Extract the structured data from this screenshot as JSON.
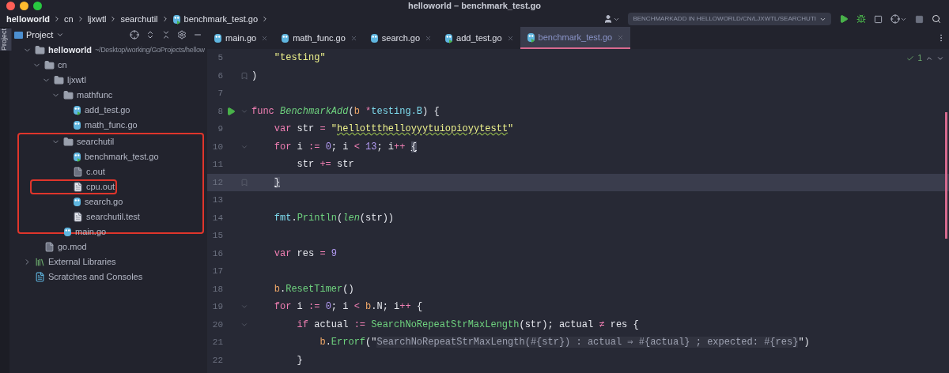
{
  "window": {
    "title": "helloworld – benchmark_test.go"
  },
  "breadcrumb": [
    {
      "label": "helloworld",
      "kind": "root"
    },
    {
      "label": "cn",
      "kind": "folder"
    },
    {
      "label": "ljxwtl",
      "kind": "folder"
    },
    {
      "label": "searchutil",
      "kind": "folder"
    },
    {
      "label": "benchmark_test.go",
      "kind": "go-test"
    }
  ],
  "toolbar": {
    "run_configuration": "BENCHMARKADD IN HELLOWORLD/CN/LJXWTL/SEARCHUTI"
  },
  "side_strip": {
    "label": "Project"
  },
  "project_panel": {
    "title": "Project",
    "tree": [
      {
        "name": "helloworld",
        "path": "~/Desktop/working/GoProjects/hellow",
        "kind": "module",
        "expanded": true,
        "children": [
          {
            "name": "cn",
            "kind": "folder",
            "expanded": true,
            "children": [
              {
                "name": "ljxwtl",
                "kind": "folder",
                "expanded": true,
                "children": [
                  {
                    "name": "mathfunc",
                    "kind": "folder",
                    "expanded": true,
                    "children": [
                      {
                        "name": "add_test.go",
                        "kind": "go-test"
                      },
                      {
                        "name": "math_func.go",
                        "kind": "go"
                      }
                    ]
                  },
                  {
                    "name": "searchutil",
                    "kind": "folder",
                    "expanded": true,
                    "annotated": true,
                    "children": [
                      {
                        "name": "benchmark_test.go",
                        "kind": "go-test"
                      },
                      {
                        "name": "c.out",
                        "kind": "binary"
                      },
                      {
                        "name": "cpu.out",
                        "kind": "text",
                        "annotated": true
                      },
                      {
                        "name": "search.go",
                        "kind": "go"
                      },
                      {
                        "name": "searchutil.test",
                        "kind": "text"
                      }
                    ]
                  },
                  {
                    "name": "main.go",
                    "kind": "go"
                  }
                ]
              }
            ]
          },
          {
            "name": "go.mod",
            "kind": "mod"
          }
        ]
      },
      {
        "name": "External Libraries",
        "kind": "library",
        "expanded": false
      },
      {
        "name": "Scratches and Consoles",
        "kind": "scratch"
      }
    ]
  },
  "tabs": [
    {
      "label": "main.go",
      "kind": "go",
      "selected": false
    },
    {
      "label": "math_func.go",
      "kind": "go",
      "selected": false
    },
    {
      "label": "search.go",
      "kind": "go",
      "selected": false
    },
    {
      "label": "add_test.go",
      "kind": "go-test",
      "selected": false
    },
    {
      "label": "benchmark_test.go",
      "kind": "go-test",
      "selected": true
    }
  ],
  "inspections": {
    "count": "1"
  },
  "code": [
    {
      "number": "5",
      "current": false,
      "tokens": [
        {
          "text": "    \"testing\"",
          "kind": "string"
        }
      ]
    },
    {
      "number": "6",
      "current": false,
      "gutter": [
        {
          "kind": "fold-end"
        }
      ],
      "tokens": [
        {
          "text": ")",
          "kind": "plain"
        }
      ]
    },
    {
      "number": "7",
      "current": false
    },
    {
      "number": "8",
      "current": false,
      "gutter": [
        {
          "kind": "run"
        },
        {
          "kind": "fold-start"
        }
      ],
      "tokens": [
        {
          "text": "func ",
          "kind": "keyword"
        },
        {
          "text": "BenchmarkAdd",
          "kind": "function"
        },
        {
          "text": "(",
          "kind": "plain"
        },
        {
          "text": "b ",
          "kind": "param"
        },
        {
          "text": "*",
          "kind": "operator"
        },
        {
          "text": "testing.B",
          "kind": "type"
        },
        {
          "text": ") {",
          "kind": "plain"
        }
      ]
    },
    {
      "number": "9",
      "current": false,
      "tokens": [
        {
          "text": "    var",
          "kind": "keyword"
        },
        {
          "text": " str ",
          "kind": "plain"
        },
        {
          "text": "= ",
          "kind": "operator"
        },
        {
          "text": "\"",
          "kind": "string"
        },
        {
          "text": "hellottthelloyyytuiopioyytestt",
          "kind": "string-typo"
        },
        {
          "text": "\"",
          "kind": "string"
        }
      ]
    },
    {
      "number": "10",
      "current": false,
      "gutter": [
        {
          "kind": "fold-start"
        }
      ],
      "tokens": [
        {
          "text": "    for",
          "kind": "keyword"
        },
        {
          "text": " i ",
          "kind": "plain"
        },
        {
          "text": ":= ",
          "kind": "operator"
        },
        {
          "text": "0",
          "kind": "number"
        },
        {
          "text": "; i ",
          "kind": "plain"
        },
        {
          "text": "< ",
          "kind": "operator"
        },
        {
          "text": "13",
          "kind": "number"
        },
        {
          "text": "; i",
          "kind": "plain"
        },
        {
          "text": "++ ",
          "kind": "operator"
        },
        {
          "text": "{",
          "kind": "brace-match"
        }
      ]
    },
    {
      "number": "11",
      "current": false,
      "tokens": [
        {
          "text": "        str ",
          "kind": "plain"
        },
        {
          "text": "+=",
          "kind": "operator"
        },
        {
          "text": " str",
          "kind": "plain"
        }
      ]
    },
    {
      "number": "12",
      "current": true,
      "gutter": [
        {
          "kind": "fold-end"
        }
      ],
      "tokens": [
        {
          "text": "    }",
          "kind": "brace-match"
        }
      ]
    },
    {
      "number": "13",
      "current": false
    },
    {
      "number": "14",
      "current": false,
      "tokens": [
        {
          "text": "    fmt",
          "kind": "type"
        },
        {
          "text": ".",
          "kind": "plain"
        },
        {
          "text": "Println",
          "kind": "method"
        },
        {
          "text": "(",
          "kind": "plain"
        },
        {
          "text": "len",
          "kind": "builtin"
        },
        {
          "text": "(str))",
          "kind": "plain"
        }
      ]
    },
    {
      "number": "15",
      "current": false
    },
    {
      "number": "16",
      "current": false,
      "tokens": [
        {
          "text": "    var",
          "kind": "keyword"
        },
        {
          "text": " res ",
          "kind": "plain"
        },
        {
          "text": "= ",
          "kind": "operator"
        },
        {
          "text": "9",
          "kind": "number"
        }
      ]
    },
    {
      "number": "17",
      "current": false
    },
    {
      "number": "18",
      "current": false,
      "tokens": [
        {
          "text": "    b",
          "kind": "param"
        },
        {
          "text": ".",
          "kind": "plain"
        },
        {
          "text": "ResetTimer",
          "kind": "method"
        },
        {
          "text": "()",
          "kind": "plain"
        }
      ]
    },
    {
      "number": "19",
      "current": false,
      "gutter": [
        {
          "kind": "fold-start"
        }
      ],
      "tokens": [
        {
          "text": "    for",
          "kind": "keyword"
        },
        {
          "text": " i ",
          "kind": "plain"
        },
        {
          "text": ":= ",
          "kind": "operator"
        },
        {
          "text": "0",
          "kind": "number"
        },
        {
          "text": "; i ",
          "kind": "plain"
        },
        {
          "text": "< ",
          "kind": "operator"
        },
        {
          "text": "b",
          "kind": "param"
        },
        {
          "text": ".N; i",
          "kind": "plain"
        },
        {
          "text": "++",
          "kind": "operator"
        },
        {
          "text": " {",
          "kind": "plain"
        }
      ]
    },
    {
      "number": "20",
      "current": false,
      "gutter": [
        {
          "kind": "fold-start"
        }
      ],
      "tokens": [
        {
          "text": "        if",
          "kind": "keyword"
        },
        {
          "text": " actual ",
          "kind": "plain"
        },
        {
          "text": ":= ",
          "kind": "operator"
        },
        {
          "text": "SearchNoRepeatStrMaxLength",
          "kind": "method"
        },
        {
          "text": "(str); actual ",
          "kind": "plain"
        },
        {
          "text": "≠",
          "kind": "operator"
        },
        {
          "text": " res {",
          "kind": "plain"
        }
      ]
    },
    {
      "number": "21",
      "current": false,
      "tokens": [
        {
          "text": "            b",
          "kind": "param"
        },
        {
          "text": ".",
          "kind": "plain"
        },
        {
          "text": "Errorf",
          "kind": "method"
        },
        {
          "text": "(\"",
          "kind": "plain"
        },
        {
          "text": "SearchNoRepeatStrMaxLength(#{str}) : actual ⇒ #{actual} ; expected: #{res}",
          "kind": "hint"
        },
        {
          "text": "\")",
          "kind": "plain"
        }
      ]
    },
    {
      "number": "22",
      "current": false,
      "tokens": [
        {
          "text": "        }",
          "kind": "plain"
        }
      ]
    }
  ]
}
